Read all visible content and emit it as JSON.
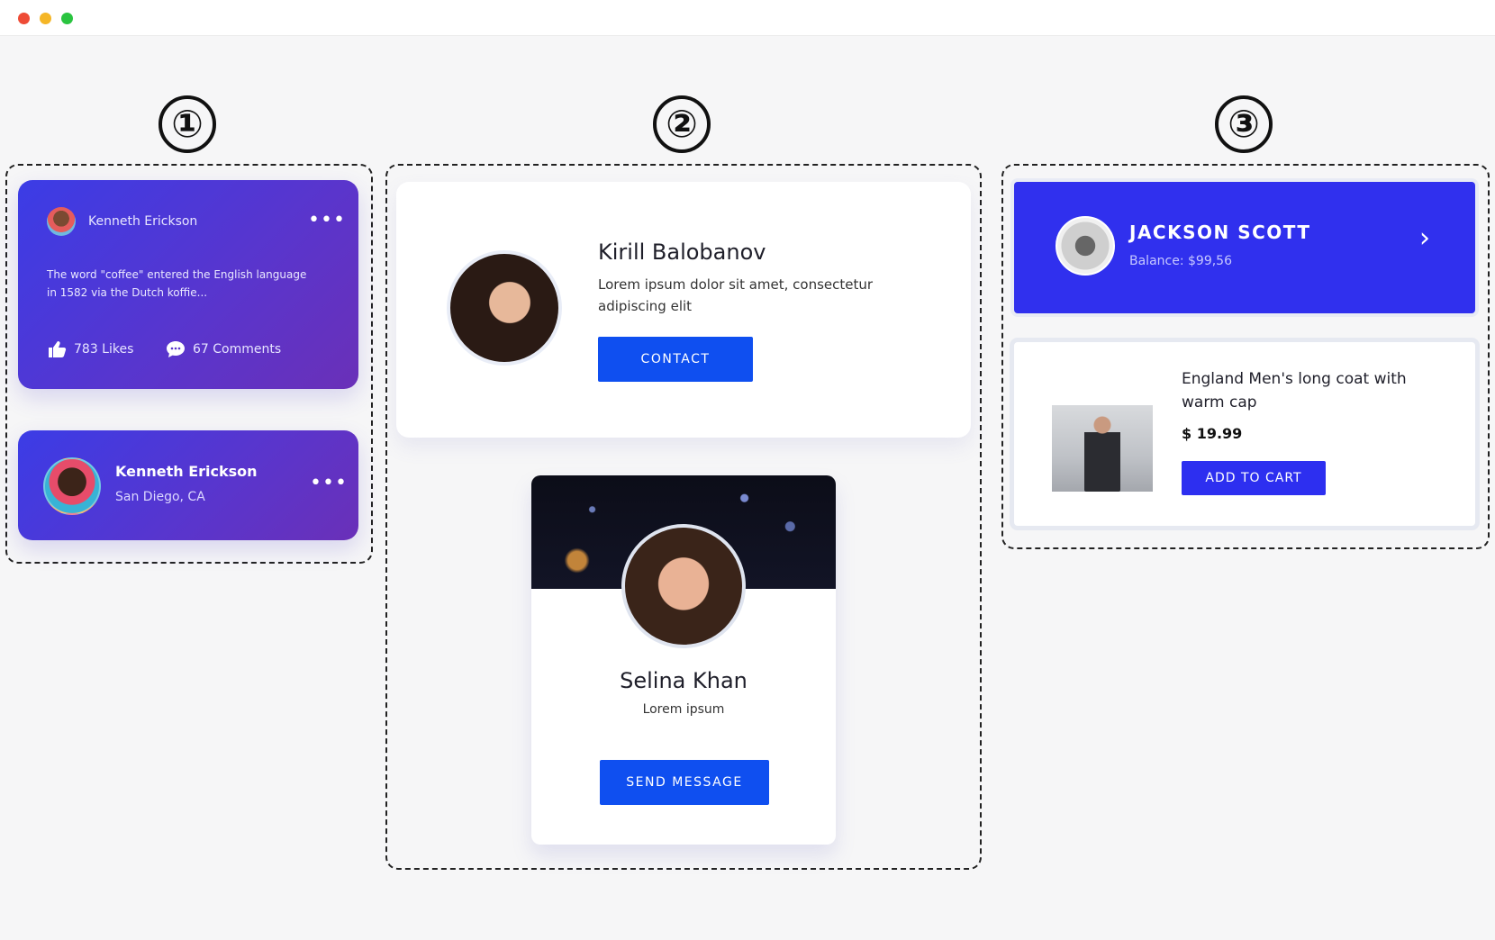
{
  "window": {
    "controls": [
      "close",
      "minimize",
      "maximize"
    ]
  },
  "groups": {
    "n1": "①",
    "n2": "②",
    "n3": "③"
  },
  "g1": {
    "post": {
      "author": "Kenneth Erickson",
      "text": "The word \"coffee\" entered the English language in 1582 via the Dutch koffie...",
      "likes": "783 Likes",
      "comments": "67 Comments",
      "more_glyph": "•••"
    },
    "profile": {
      "name": "Kenneth Erickson",
      "location": "San Diego, CA",
      "more_glyph": "•••"
    }
  },
  "g2": {
    "card1": {
      "name": "Kirill Balobanov",
      "desc": "Lorem ipsum dolor sit amet, consectetur adipiscing elit",
      "button": "CONTACT"
    },
    "card2": {
      "name": "Selina Khan",
      "sub": "Lorem ipsum",
      "button": "SEND MESSAGE"
    }
  },
  "g3": {
    "account": {
      "name": "JACKSON SCOTT",
      "balance": "Balance: $99,56",
      "chevron": "›"
    },
    "product": {
      "title": "England Men's long coat with warm cap",
      "price": "$ 19.99",
      "button": "ADD TO CART"
    }
  },
  "colors": {
    "background": "#f6f6f7",
    "group1_gradient_start": "#3b3ce6",
    "group1_gradient_end": "#6a30b8",
    "primary_button": "#0f4ff0",
    "group3_accent": "#3030ee"
  },
  "icons": {
    "like": "thumbs-up-icon",
    "comment": "comment-bubble-icon",
    "more": "more-dots-icon",
    "chevron": "chevron-right-icon"
  }
}
